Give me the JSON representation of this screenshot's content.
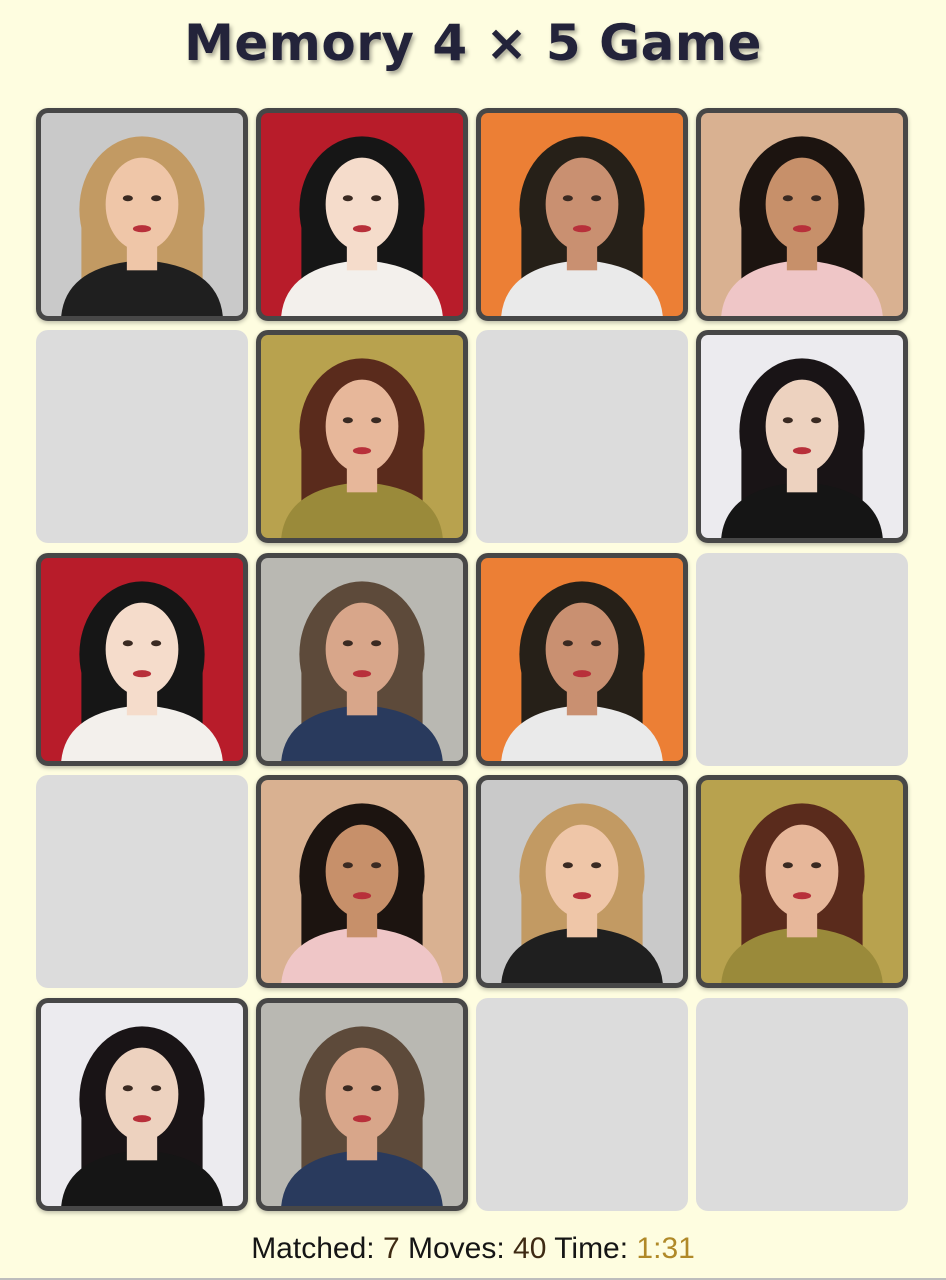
{
  "title": "Memory 4 × 5 Game",
  "status": {
    "matched_label": "Matched:",
    "matched_value": "7",
    "moves_label": "Moves:",
    "moves_value": "40",
    "time_label": "Time:",
    "time_value": "1:31"
  },
  "grid": {
    "rows": 5,
    "cols": 4
  },
  "cards": [
    {
      "state": "revealed",
      "photo": "blonde-woman-portrait",
      "bg": "#c9c9c9",
      "hair": "#c29a63",
      "skin": "#efc6a8",
      "cloth": "#1f1f1f",
      "accent": "#f3eee2"
    },
    {
      "state": "revealed",
      "photo": "dark-hair-woman-red-backdrop",
      "bg": "#b81c2a",
      "hair": "#161616",
      "skin": "#f5dccb",
      "cloth": "#f3f0ec",
      "accent": "#f3f0ec"
    },
    {
      "state": "revealed",
      "photo": "man-orange-backdrop",
      "bg": "#ec7f35",
      "hair": "#262018",
      "skin": "#c99071",
      "cloth": "#eaeaea",
      "accent": "#eaeaea"
    },
    {
      "state": "revealed",
      "photo": "woman-curly-hair-sunset",
      "bg": "#d9b191",
      "hair": "#1c1410",
      "skin": "#c7906a",
      "cloth": "#efc6c7",
      "accent": "#2a2f2c"
    },
    {
      "state": "hidden"
    },
    {
      "state": "revealed",
      "photo": "woman-in-grass-field",
      "bg": "#b8a24e",
      "hair": "#5a2b1c",
      "skin": "#e7b79a",
      "cloth": "#9a8a3a",
      "accent": "#e7b79a"
    },
    {
      "state": "hidden"
    },
    {
      "state": "revealed",
      "photo": "woman-holding-red-rose",
      "bg": "#ecebef",
      "hair": "#191416",
      "skin": "#edd2bf",
      "cloth": "#151515",
      "accent": "#c41f22"
    },
    {
      "state": "revealed",
      "photo": "dark-hair-woman-red-backdrop",
      "bg": "#b81c2a",
      "hair": "#161616",
      "skin": "#f5dccb",
      "cloth": "#f3f0ec",
      "accent": "#f3f0ec"
    },
    {
      "state": "revealed",
      "photo": "man-in-suit-outdoors",
      "bg": "#b9b8b2",
      "hair": "#5d4a3a",
      "skin": "#d8a68a",
      "cloth": "#293a5d",
      "accent": "#ffffff"
    },
    {
      "state": "revealed",
      "photo": "man-orange-backdrop",
      "bg": "#ec7f35",
      "hair": "#262018",
      "skin": "#c99071",
      "cloth": "#eaeaea",
      "accent": "#eaeaea"
    },
    {
      "state": "hidden"
    },
    {
      "state": "hidden"
    },
    {
      "state": "revealed",
      "photo": "woman-curly-hair-sunset",
      "bg": "#d9b191",
      "hair": "#1c1410",
      "skin": "#c7906a",
      "cloth": "#efc6c7",
      "accent": "#2a2f2c"
    },
    {
      "state": "revealed",
      "photo": "blonde-woman-portrait",
      "bg": "#c9c9c9",
      "hair": "#c29a63",
      "skin": "#efc6a8",
      "cloth": "#1f1f1f",
      "accent": "#f3eee2"
    },
    {
      "state": "revealed",
      "photo": "woman-in-grass-field",
      "bg": "#b8a24e",
      "hair": "#5a2b1c",
      "skin": "#e7b79a",
      "cloth": "#9a8a3a",
      "accent": "#e7b79a"
    },
    {
      "state": "revealed",
      "photo": "woman-holding-red-rose",
      "bg": "#ecebef",
      "hair": "#191416",
      "skin": "#edd2bf",
      "cloth": "#151515",
      "accent": "#c41f22"
    },
    {
      "state": "revealed",
      "photo": "man-in-suit-outdoors",
      "bg": "#b9b8b2",
      "hair": "#5d4a3a",
      "skin": "#d8a68a",
      "cloth": "#293a5d",
      "accent": "#ffffff"
    },
    {
      "state": "hidden"
    },
    {
      "state": "hidden"
    }
  ],
  "colors": {
    "page_bg": "#fefde0",
    "card_hidden": "#dcdcdc",
    "card_frame": "#474747",
    "title": "#23233a",
    "time": "#b08928"
  }
}
